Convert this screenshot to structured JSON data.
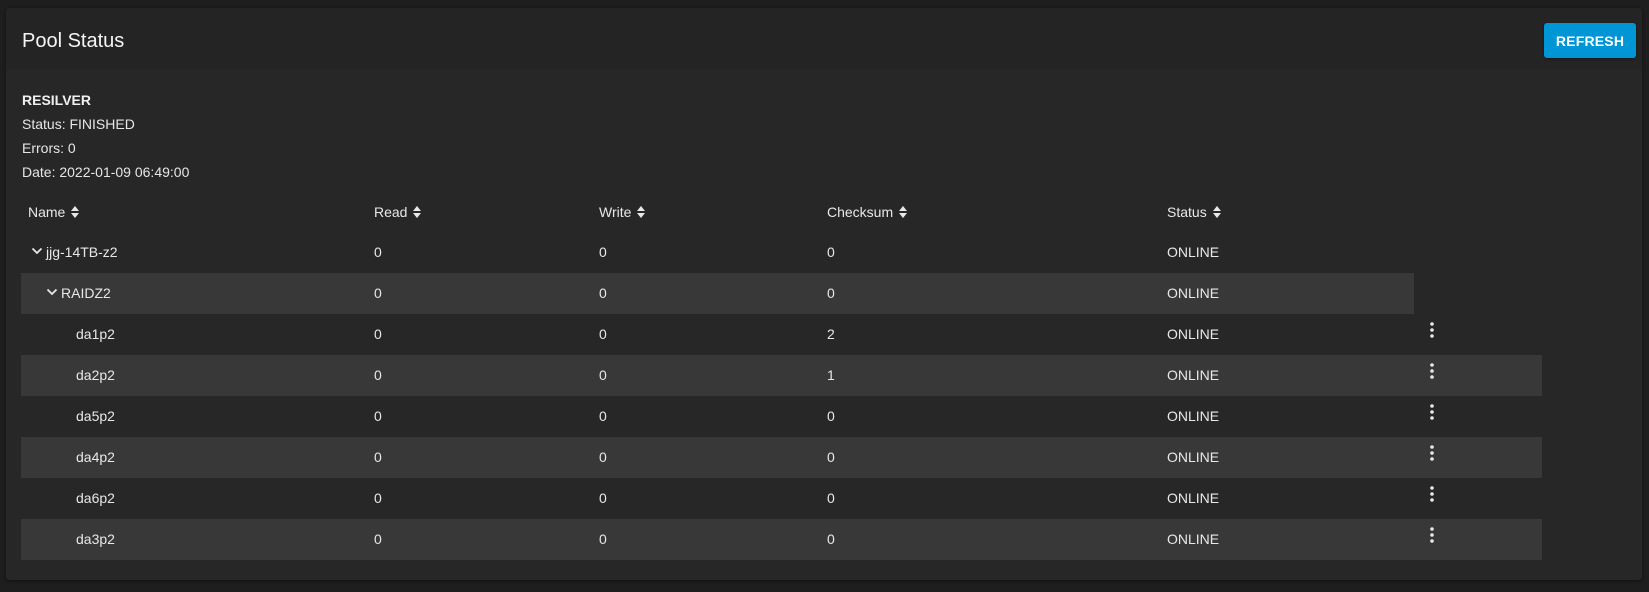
{
  "card": {
    "title": "Pool Status",
    "refresh_label": "REFRESH"
  },
  "scan": {
    "title": "RESILVER",
    "status": "Status: FINISHED",
    "errors": "Errors: 0",
    "date": "Date: 2022-01-09 06:49:00"
  },
  "table": {
    "columns": {
      "name": "Name",
      "read": "Read",
      "write": "Write",
      "checksum": "Checksum",
      "status": "Status"
    },
    "rows": [
      {
        "name": "jjg-14TB-z2",
        "read": "0",
        "write": "0",
        "checksum": "0",
        "status": "ONLINE"
      },
      {
        "name": "RAIDZ2",
        "read": "0",
        "write": "0",
        "checksum": "0",
        "status": "ONLINE"
      },
      {
        "name": "da1p2",
        "read": "0",
        "write": "0",
        "checksum": "2",
        "status": "ONLINE"
      },
      {
        "name": "da2p2",
        "read": "0",
        "write": "0",
        "checksum": "1",
        "status": "ONLINE"
      },
      {
        "name": "da5p2",
        "read": "0",
        "write": "0",
        "checksum": "0",
        "status": "ONLINE"
      },
      {
        "name": "da4p2",
        "read": "0",
        "write": "0",
        "checksum": "0",
        "status": "ONLINE"
      },
      {
        "name": "da6p2",
        "read": "0",
        "write": "0",
        "checksum": "0",
        "status": "ONLINE"
      },
      {
        "name": "da3p2",
        "read": "0",
        "write": "0",
        "checksum": "0",
        "status": "ONLINE"
      }
    ]
  },
  "icons": {
    "sort": "sort-icon",
    "expand": "chevron-down-icon",
    "more": "more-vert-icon"
  },
  "colors": {
    "accent": "#0095d5",
    "background": "#1e1e1e",
    "card": "#272727",
    "stripe": "#383838",
    "text": "#e8e8e8"
  }
}
